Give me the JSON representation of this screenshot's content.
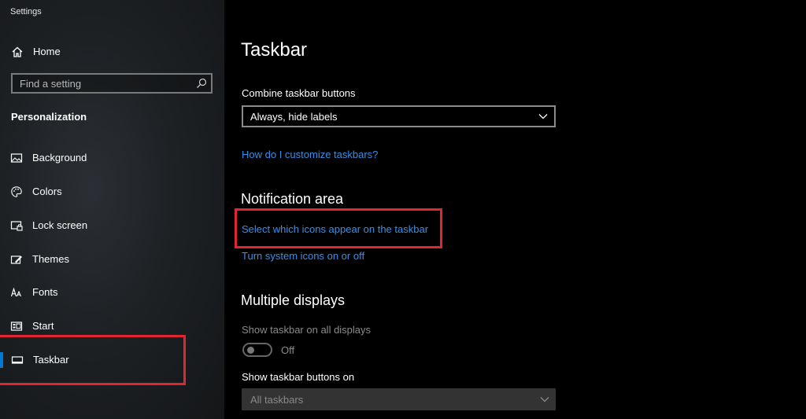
{
  "app": {
    "title": "Settings"
  },
  "sidebar": {
    "home_label": "Home",
    "search_placeholder": "Find a setting",
    "section_title": "Personalization",
    "items": [
      {
        "label": "Background",
        "icon": "picture-icon"
      },
      {
        "label": "Colors",
        "icon": "palette-icon"
      },
      {
        "label": "Lock screen",
        "icon": "lock-screen-icon"
      },
      {
        "label": "Themes",
        "icon": "themes-icon"
      },
      {
        "label": "Fonts",
        "icon": "fonts-icon"
      },
      {
        "label": "Start",
        "icon": "start-icon"
      },
      {
        "label": "Taskbar",
        "icon": "taskbar-icon",
        "selected": true
      }
    ]
  },
  "main": {
    "title": "Taskbar",
    "combine": {
      "label": "Combine taskbar buttons",
      "value": "Always, hide labels"
    },
    "customize_link": "How do I customize taskbars?",
    "notification_area": {
      "heading": "Notification area",
      "select_icons_link": "Select which icons appear on the taskbar",
      "system_icons_link": "Turn system icons on or off"
    },
    "multiple_displays": {
      "heading": "Multiple displays",
      "show_all_label": "Show taskbar on all displays",
      "toggle_state": "Off",
      "show_buttons_label": "Show taskbar buttons on",
      "show_buttons_value": "All taskbars"
    }
  },
  "colors": {
    "accent": "#0078d7",
    "link": "#3a8ee6",
    "highlight": "#e0262f"
  }
}
